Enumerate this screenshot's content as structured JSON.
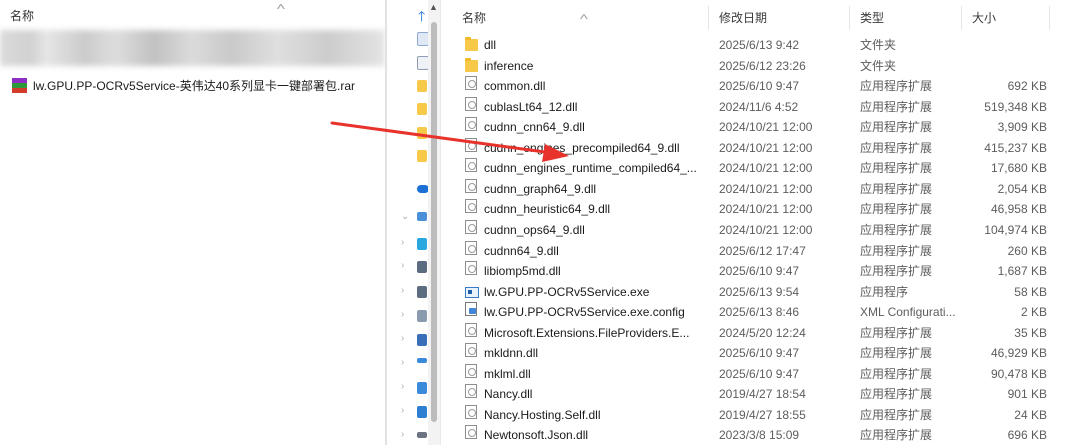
{
  "left_pane": {
    "column_header": "名称",
    "file_name": "lw.GPU.PP-OCRv5Service-英伟达40系列显卡一键部署包.rar"
  },
  "right_pane": {
    "columns": {
      "name": "名称",
      "date": "修改日期",
      "type": "类型",
      "size": "大小"
    },
    "files": [
      {
        "name": "dll",
        "date": "2025/6/13 9:42",
        "type": "文件夹",
        "size": "",
        "icon": "folder"
      },
      {
        "name": "inference",
        "date": "2025/6/12 23:26",
        "type": "文件夹",
        "size": "",
        "icon": "folder"
      },
      {
        "name": "common.dll",
        "date": "2025/6/10 9:47",
        "type": "应用程序扩展",
        "size": "692 KB",
        "icon": "dll"
      },
      {
        "name": "cublasLt64_12.dll",
        "date": "2024/11/6 4:52",
        "type": "应用程序扩展",
        "size": "519,348 KB",
        "icon": "dll"
      },
      {
        "name": "cudnn_cnn64_9.dll",
        "date": "2024/10/21 12:00",
        "type": "应用程序扩展",
        "size": "3,909 KB",
        "icon": "dll"
      },
      {
        "name": "cudnn_engines_precompiled64_9.dll",
        "date": "2024/10/21 12:00",
        "type": "应用程序扩展",
        "size": "415,237 KB",
        "icon": "dll"
      },
      {
        "name": "cudnn_engines_runtime_compiled64_...",
        "date": "2024/10/21 12:00",
        "type": "应用程序扩展",
        "size": "17,680 KB",
        "icon": "dll"
      },
      {
        "name": "cudnn_graph64_9.dll",
        "date": "2024/10/21 12:00",
        "type": "应用程序扩展",
        "size": "2,054 KB",
        "icon": "dll"
      },
      {
        "name": "cudnn_heuristic64_9.dll",
        "date": "2024/10/21 12:00",
        "type": "应用程序扩展",
        "size": "46,958 KB",
        "icon": "dll"
      },
      {
        "name": "cudnn_ops64_9.dll",
        "date": "2024/10/21 12:00",
        "type": "应用程序扩展",
        "size": "104,974 KB",
        "icon": "dll"
      },
      {
        "name": "cudnn64_9.dll",
        "date": "2025/6/12 17:47",
        "type": "应用程序扩展",
        "size": "260 KB",
        "icon": "dll"
      },
      {
        "name": "libiomp5md.dll",
        "date": "2025/6/10 9:47",
        "type": "应用程序扩展",
        "size": "1,687 KB",
        "icon": "dll"
      },
      {
        "name": "lw.GPU.PP-OCRv5Service.exe",
        "date": "2025/6/13 9:54",
        "type": "应用程序",
        "size": "58 KB",
        "icon": "exe"
      },
      {
        "name": "lw.GPU.PP-OCRv5Service.exe.config",
        "date": "2025/6/13 8:46",
        "type": "XML Configurati...",
        "size": "2 KB",
        "icon": "cfg"
      },
      {
        "name": "Microsoft.Extensions.FileProviders.E...",
        "date": "2024/5/20 12:24",
        "type": "应用程序扩展",
        "size": "35 KB",
        "icon": "dll"
      },
      {
        "name": "mkldnn.dll",
        "date": "2025/6/10 9:47",
        "type": "应用程序扩展",
        "size": "46,929 KB",
        "icon": "dll"
      },
      {
        "name": "mklml.dll",
        "date": "2025/6/10 9:47",
        "type": "应用程序扩展",
        "size": "90,478 KB",
        "icon": "dll"
      },
      {
        "name": "Nancy.dll",
        "date": "2019/4/27 18:54",
        "type": "应用程序扩展",
        "size": "901 KB",
        "icon": "dll"
      },
      {
        "name": "Nancy.Hosting.Self.dll",
        "date": "2019/4/27 18:55",
        "type": "应用程序扩展",
        "size": "24 KB",
        "icon": "dll"
      },
      {
        "name": "Newtonsoft.Json.dll",
        "date": "2023/3/8 15:09",
        "type": "应用程序扩展",
        "size": "696 KB",
        "icon": "dll"
      }
    ]
  },
  "colors": {
    "annotation_arrow": "#e8322c",
    "folder": "#f7c948",
    "accent": "#1b6fd6"
  }
}
